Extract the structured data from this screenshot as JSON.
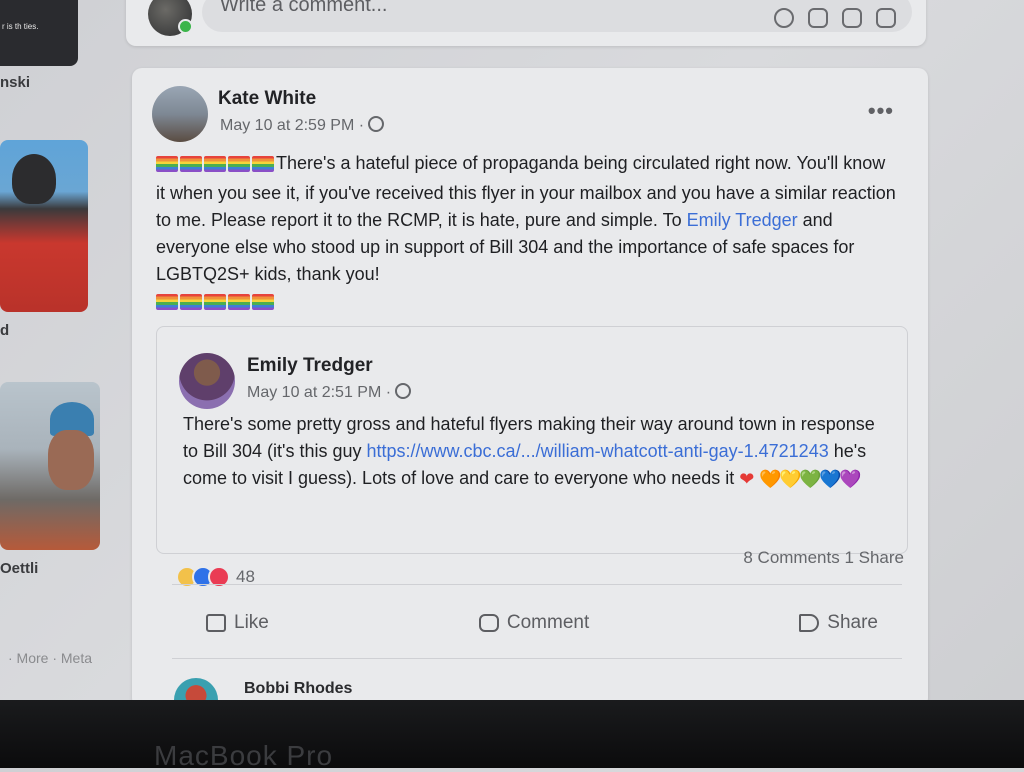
{
  "sidebar": {
    "top_thumb_text": "r is th\nties.",
    "names": [
      "nski",
      "d",
      "Oettli"
    ],
    "footer": "· More · Meta"
  },
  "comment_composer": {
    "placeholder": "Write a comment...",
    "icons": [
      "emoji-icon",
      "camera-icon",
      "gif-icon",
      "sticker-icon"
    ]
  },
  "post": {
    "author": "Kate White",
    "timestamp": "May 10 at 2:59 PM ·",
    "text_part1": "There's a hateful piece of propaganda being circulated right now. You'll know it when you see it,  if you've received this flyer in your mailbox and you have a similar reaction to me. Please report it to the RCMP, it is hate, pure and simple. To ",
    "mention": "Emily Tredger",
    "text_part2": " and everyone else who stood up in support of Bill 304 and the importance of safe spaces for LGBTQ2S+  kids, thank you!",
    "flag_count": 5,
    "shared": {
      "author": "Emily Tredger",
      "timestamp": "May 10 at 2:51 PM ·",
      "text_part1": "There's some pretty gross and hateful flyers making their way around town in response to Bill 304 (it's this guy ",
      "link": "https://www.cbc.ca/.../william-whatcott-anti-gay-1.4721243",
      "text_part2": " he's come to visit I guess). Lots of love and care to everyone who needs it ",
      "hearts": [
        "❤",
        "🧡",
        "💛",
        "💚",
        "💙",
        "💜"
      ]
    },
    "reaction_count": "48",
    "comments_shares": "8 Comments  1 Share",
    "actions": {
      "like": "Like",
      "comment": "Comment",
      "share": "Share"
    },
    "next_commenter": "Bobbi Rhodes"
  },
  "device_label": "MacBook Pro",
  "colors": {
    "link": "#3b6ed6",
    "card": "#e9eaec",
    "online": "#3bb54a"
  }
}
